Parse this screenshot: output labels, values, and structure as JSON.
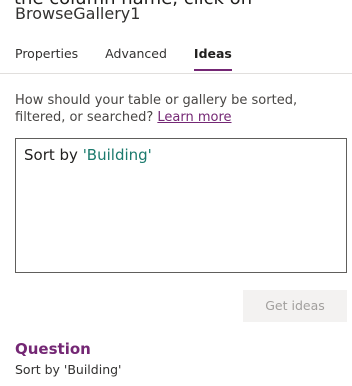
{
  "caption_cropped": "the column name, click on",
  "panel": {
    "control_name": "BrowseGallery1",
    "tabs": [
      {
        "label": "Properties",
        "active": false
      },
      {
        "label": "Advanced",
        "active": false
      },
      {
        "label": "Ideas",
        "active": true
      }
    ],
    "accent_color": "#742774"
  },
  "ideas": {
    "prompt": "How should your table or gallery be sorted, filtered, or searched?",
    "learn_more": "Learn more",
    "query_prefix": "Sort by ",
    "query_quoted": "'Building'",
    "query_quoted_color": "#1b7a6d",
    "get_ideas_label": "Get ideas",
    "question_heading": "Question",
    "question_text": "Sort by 'Building'"
  }
}
